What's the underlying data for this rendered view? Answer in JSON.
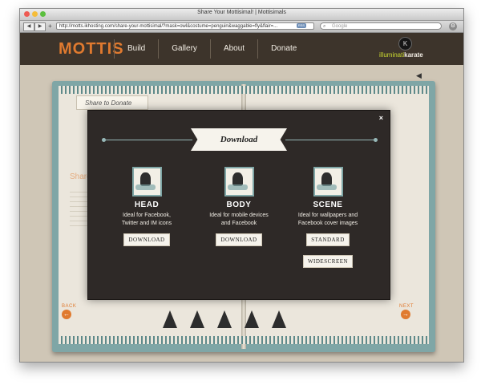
{
  "browser": {
    "window_title": "Share Your Mottisimal! | Mottisimals",
    "url": "http://motts.ikhosting.com/share-your-mottisimal/?mask=owl&costume=penguin&waggable=fly&flair=...",
    "search_placeholder": "Google",
    "back_glyph": "◀",
    "forward_glyph": "▶",
    "add_glyph": "+",
    "rss_label": "RSS",
    "search_glyph": "⌕",
    "settings_glyph": "⚙"
  },
  "site": {
    "logo": "MOTTIS",
    "nav": [
      "Build",
      "Gallery",
      "About",
      "Donate"
    ],
    "brand_mark": "K",
    "brand_prefix": "illuminati",
    "brand_name": "karate"
  },
  "book": {
    "share_tab": "Share to Donate",
    "ghost_title": "Share your Mottisimal!",
    "speaker_glyph": "◀",
    "back_label": "BACK",
    "next_label": "NEXT",
    "back_arrow": "←",
    "next_arrow": "→"
  },
  "modal": {
    "title": "Download",
    "close": "×",
    "options": [
      {
        "name": "HEAD",
        "desc": [
          "Ideal for Facebook,",
          "Twitter and IM icons"
        ],
        "buttons": [
          "DOWNLOAD"
        ]
      },
      {
        "name": "BODY",
        "desc": [
          "Ideal for mobile devices",
          "and Facebook"
        ],
        "buttons": [
          "DOWNLOAD"
        ]
      },
      {
        "name": "SCENE",
        "desc": [
          "Ideal for wallpapers and",
          "Facebook cover images"
        ],
        "buttons": [
          "STANDARD",
          "WIDESCREEN"
        ]
      }
    ]
  },
  "colors": {
    "header_bg": "#3d342b",
    "accent_orange": "#e07a2f",
    "book_teal": "#7fa6a6",
    "modal_bg": "#2e2927"
  }
}
